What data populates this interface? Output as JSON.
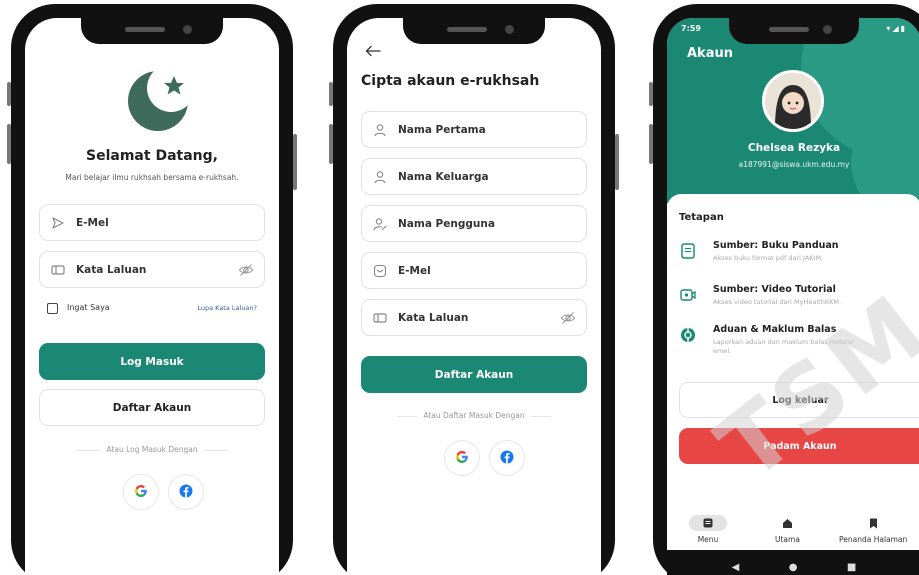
{
  "colors": {
    "accent": "#1b8873",
    "danger": "#e84545",
    "header_deco": "#3aa38f"
  },
  "screen1": {
    "welcome_title": "Selamat Datang,",
    "welcome_subtitle": "Mari belajar ilmu rukhsah bersama e-rukhsah.",
    "email_label": "E-Mel",
    "password_label": "Kata Laluan",
    "remember_label": "Ingat Saya",
    "forgot_link": "Lupa Kata Laluan?",
    "login_button": "Log Masuk",
    "register_button": "Daftar Akaun",
    "divider_text": "Atau Log Masuk Dengan",
    "icons": [
      "moon-star-logo-icon",
      "send-icon",
      "password-icon",
      "eye-off-icon",
      "google-icon",
      "facebook-icon"
    ]
  },
  "screen2": {
    "title": "Cipta akaun e-rukhsah",
    "fields": {
      "first_name": "Nama Pertama",
      "last_name": "Nama Keluarga",
      "username": "Nama Pengguna",
      "email": "E-Mel",
      "password": "Kata Laluan"
    },
    "register_button": "Daftar Akaun",
    "divider_text": "Atau Daftar Masuk Dengan",
    "icons": [
      "back-arrow-icon",
      "user-icon",
      "user-edit-icon",
      "mail-icon",
      "password-icon",
      "eye-off-icon",
      "google-icon",
      "facebook-icon"
    ]
  },
  "screen3": {
    "status_time": "7:59",
    "header_title": "Akaun",
    "user_name": "Chelsea Rezyka",
    "user_email": "a187991@siswa.ukm.edu.my",
    "settings_title": "Tetapan",
    "settings": [
      {
        "title": "Sumber: Buku Panduan",
        "subtitle": "Akses buku format pdf dari JAKIM.",
        "icon": "book-icon"
      },
      {
        "title": "Sumber: Video Tutorial",
        "subtitle": "Akses video tutorial dari MyHealthKKM.",
        "icon": "video-icon"
      },
      {
        "title": "Aduan & Maklum Balas",
        "subtitle": "Laporkan aduan dan maklum balas melalui emel.",
        "icon": "feedback-icon"
      }
    ],
    "logout_button": "Log keluar",
    "delete_button": "Padam Akaun",
    "nav": {
      "menu": "Menu",
      "home": "Utama",
      "bookmark": "Penanda Halaman"
    }
  },
  "watermark": "TSM"
}
